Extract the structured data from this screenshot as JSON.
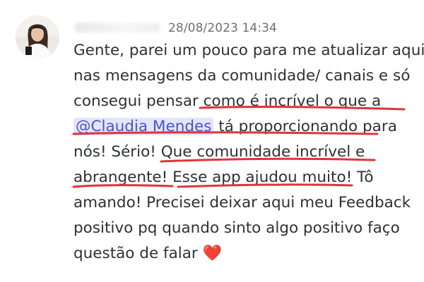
{
  "message": {
    "timestamp": "28/08/2023 14:34",
    "lines": {
      "l1": "Gente, parei um pouco para me atualizar aqui",
      "l2": "nas mensagens da comunidade/ canais e só",
      "l3": "consegui pensar como é incrível o que a",
      "l4_mention": "@Claudia Mendes",
      "l4_rest": " tá proporcionando para",
      "l5": "nós! Sério! Que comunidade incrível e",
      "l6": "abrangente! Esse app ajudou muito! Tô",
      "l7": "amando! Precisei deixar aqui meu Feedback",
      "l8": "positivo pq quando sinto algo positivo faço",
      "l9": "questão de falar "
    },
    "heart": "❤️"
  },
  "colors": {
    "mention_bg": "#e3e5fb",
    "mention_text": "#4a55c8",
    "annotation_red": "#e0333d",
    "text": "#2e3035",
    "timestamp": "#6d6f78"
  },
  "icons": {
    "avatar": "user-avatar-photo",
    "heart": "red-heart-emoji"
  }
}
